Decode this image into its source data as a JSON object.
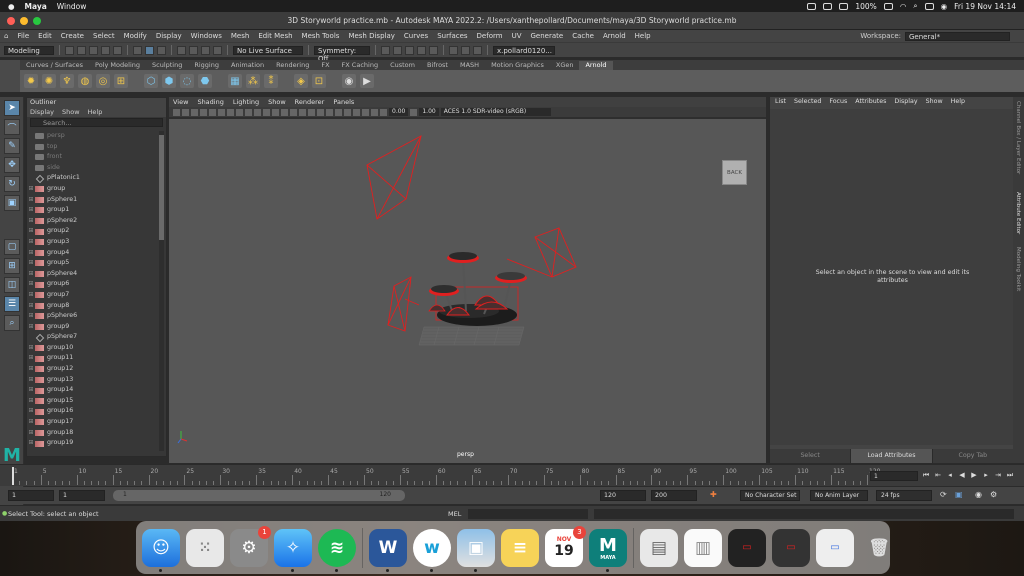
{
  "menubar": {
    "app_name": "Maya",
    "items": [
      "Window"
    ],
    "battery": "100%",
    "datetime": "Fri 19 Nov  14:14"
  },
  "window": {
    "title": "3D Storyworld practice.mb - Autodesk MAYA 2022.2: /Users/xanthepollard/Documents/maya/3D Storyworld practice.mb"
  },
  "maya_menu": {
    "items": [
      "File",
      "Edit",
      "Create",
      "Select",
      "Modify",
      "Display",
      "Windows",
      "Mesh",
      "Edit Mesh",
      "Mesh Tools",
      "Mesh Display",
      "Curves",
      "Surfaces",
      "Deform",
      "UV",
      "Generate",
      "Cache",
      "Arnold",
      "Help"
    ],
    "workspace_label": "Workspace:",
    "workspace_value": "General*"
  },
  "status_line": {
    "menuset": "Modeling",
    "live_surface": "No Live Surface",
    "symmetry": "Symmetry: Off",
    "user": "x.pollard0120..."
  },
  "shelf": {
    "tabs": [
      "Curves / Surfaces",
      "Poly Modeling",
      "Sculpting",
      "Rigging",
      "Animation",
      "Rendering",
      "FX",
      "FX Caching",
      "Custom",
      "Bifrost",
      "MASH",
      "Motion Graphics",
      "XGen",
      "Arnold"
    ],
    "active_tab": "Arnold"
  },
  "outliner": {
    "title": "Outliner",
    "menu": [
      "Display",
      "Show",
      "Help"
    ],
    "search_placeholder": "Search...",
    "items": [
      {
        "label": "persp",
        "type": "cam",
        "dim": true
      },
      {
        "label": "top",
        "type": "cam",
        "dim": true
      },
      {
        "label": "front",
        "type": "cam",
        "dim": true
      },
      {
        "label": "side",
        "type": "cam",
        "dim": true
      },
      {
        "label": "pPlatonic1",
        "type": "plat"
      },
      {
        "label": "group",
        "type": "grp"
      },
      {
        "label": "pSphere1",
        "type": "grp"
      },
      {
        "label": "group1",
        "type": "grp"
      },
      {
        "label": "pSphere2",
        "type": "grp"
      },
      {
        "label": "group2",
        "type": "grp"
      },
      {
        "label": "group3",
        "type": "grp"
      },
      {
        "label": "group4",
        "type": "grp"
      },
      {
        "label": "group5",
        "type": "grp"
      },
      {
        "label": "pSphere4",
        "type": "grp"
      },
      {
        "label": "group6",
        "type": "grp"
      },
      {
        "label": "group7",
        "type": "grp"
      },
      {
        "label": "group8",
        "type": "grp"
      },
      {
        "label": "pSphere6",
        "type": "grp"
      },
      {
        "label": "group9",
        "type": "grp"
      },
      {
        "label": "pSphere7",
        "type": "plat"
      },
      {
        "label": "group10",
        "type": "grp"
      },
      {
        "label": "group11",
        "type": "grp"
      },
      {
        "label": "group12",
        "type": "grp"
      },
      {
        "label": "group13",
        "type": "grp"
      },
      {
        "label": "group14",
        "type": "grp"
      },
      {
        "label": "group15",
        "type": "grp"
      },
      {
        "label": "group16",
        "type": "grp"
      },
      {
        "label": "group17",
        "type": "grp"
      },
      {
        "label": "group18",
        "type": "grp"
      },
      {
        "label": "group19",
        "type": "grp"
      }
    ]
  },
  "viewport": {
    "menu": [
      "View",
      "Shading",
      "Lighting",
      "Show",
      "Renderer",
      "Panels"
    ],
    "exposure": "0.00",
    "gamma": "1.00",
    "color_space": "ACES 1.0 SDR-video (sRGB)",
    "viewcube_label": "BACK",
    "camera_label": "persp"
  },
  "attribute_editor": {
    "menu": [
      "List",
      "Selected",
      "Focus",
      "Attributes",
      "Display",
      "Show",
      "Help"
    ],
    "message": "Select an object in the scene to view and edit its attributes",
    "buttons": [
      "Select",
      "Load Attributes",
      "Copy Tab"
    ]
  },
  "side_tabs": [
    "Channel Box / Layer Editor",
    "Attribute Editor",
    "Modeling Toolkit"
  ],
  "time_slider": {
    "tick_labels": [
      "1",
      "5",
      "10",
      "15",
      "20",
      "25",
      "30",
      "35",
      "40",
      "45",
      "50",
      "55",
      "60",
      "65",
      "70",
      "75",
      "80",
      "85",
      "90",
      "95",
      "100",
      "105",
      "110",
      "115",
      "120"
    ],
    "start": 1,
    "end": 120,
    "current_frame_value": 1,
    "current_frame": "1"
  },
  "range_slider": {
    "start": "1",
    "playback_start": "1",
    "range_start_label": "1",
    "range_end_label": "120",
    "playback_end": "120",
    "end": "200",
    "character_set": "No Character Set",
    "anim_layer": "No Anim Layer",
    "fps": "24 fps"
  },
  "command_line": {
    "help_text": "Select Tool: select an object",
    "mel_label": "MEL"
  },
  "dock": {
    "calendar_month": "NOV",
    "calendar_day": "19",
    "settings_badge": "1",
    "calendar_badge": "3",
    "maya_label": "MAYA"
  },
  "colors": {
    "selection_red": "#e02020",
    "maya_teal": "#20b3a6",
    "active_blue": "#5a86aa"
  }
}
